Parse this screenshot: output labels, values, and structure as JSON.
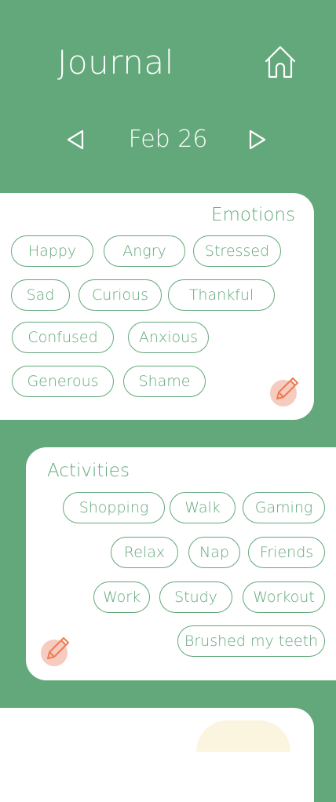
{
  "header": {
    "title": "Journal",
    "home_icon": "home-icon"
  },
  "date_nav": {
    "prev_icon": "triangle-left-icon",
    "date": "Feb 26",
    "next_icon": "triangle-right-icon"
  },
  "emotions": {
    "title": "Emotions",
    "chips": [
      "Happy",
      "Angry",
      "Stressed",
      "Sad",
      "Curious",
      "Thankful",
      "Confused",
      "Anxious",
      "Generous",
      "Shame"
    ],
    "edit_icon": "pencil-icon"
  },
  "activities": {
    "title": "Activities",
    "chips": [
      "Shopping",
      "Walk",
      "Gaming",
      "Relax",
      "Nap",
      "Friends",
      "Work",
      "Study",
      "Workout",
      "Brushed my teeth"
    ],
    "edit_icon": "pencil-icon"
  },
  "colors": {
    "background": "#63a87b",
    "card": "#ffffff",
    "accent": "#63a87b",
    "edit": "#f07a4f",
    "edit_bg": "#f6cbc0"
  }
}
